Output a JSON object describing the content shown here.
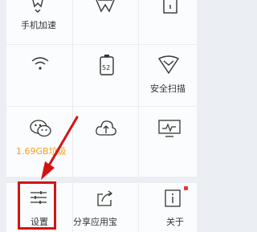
{
  "grid": {
    "row1": {
      "col1_label": "手机加速"
    },
    "row2": {
      "col2_badge": "52",
      "col3_label": "安全扫描"
    },
    "row3": {
      "col1_label": "1.69GB垃圾"
    }
  },
  "bottom": {
    "settings_label": "设置",
    "share_label": "分享应用宝",
    "about_label": "关于"
  },
  "colors": {
    "highlight": "#d31313",
    "junk_text": "#f0a020",
    "icon_stroke": "#333333"
  }
}
